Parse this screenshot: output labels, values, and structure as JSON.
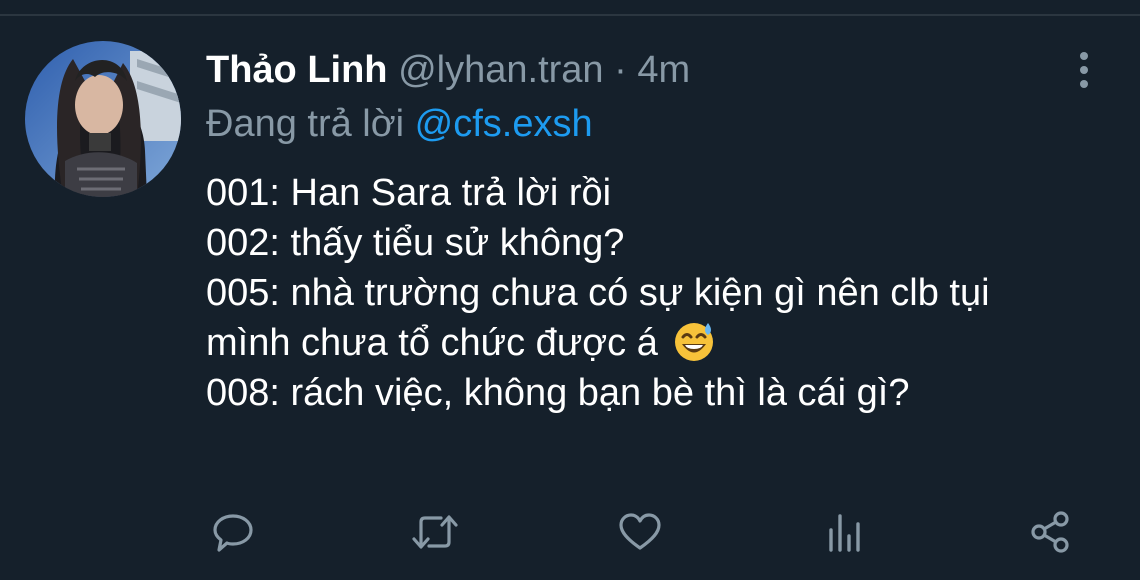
{
  "tweet": {
    "author": {
      "display_name": "Thảo Linh",
      "handle": "@lyhan.tran",
      "separator": "·",
      "time": "4m",
      "avatar": "profile-photo"
    },
    "reply": {
      "prefix": "Đang trả lời ",
      "mention": "@cfs.exsh"
    },
    "lines": [
      "001: Han Sara trả lời rồi",
      "002: thấy tiểu sử không?",
      "005: nhà trường chưa có sự kiện gì nên clb tụi",
      "mình chưa tổ chức được á",
      "008: rách việc, không bạn bè thì là cái gì?"
    ],
    "emoji": "grinning-sweat-emoji"
  },
  "actions": [
    {
      "name": "reply",
      "icon": "comment-icon"
    },
    {
      "name": "retweet",
      "icon": "retweet-icon"
    },
    {
      "name": "like",
      "icon": "heart-icon"
    },
    {
      "name": "analytics",
      "icon": "analytics-icon"
    },
    {
      "name": "share",
      "icon": "share-icon"
    }
  ],
  "colors": {
    "background": "#15202b",
    "primary_text": "#ffffff",
    "secondary_text": "#8899a6",
    "accent": "#1d9bf0",
    "icon": "#8899a6"
  }
}
